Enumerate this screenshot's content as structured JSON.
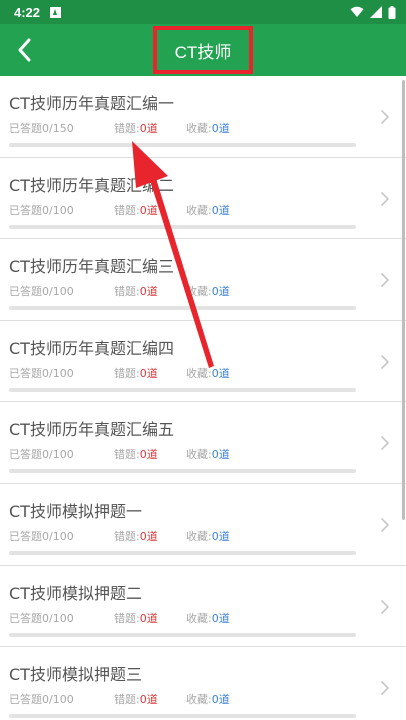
{
  "status_bar": {
    "time": "4:22",
    "icons": [
      "notification-a-icon",
      "wifi-icon",
      "signal-icon",
      "battery-icon"
    ]
  },
  "header": {
    "title": "CT技师",
    "back_icon": "back-arrow-icon"
  },
  "labels": {
    "answered": "已答题",
    "wrong": "错题:",
    "favorites": "收藏:"
  },
  "items": [
    {
      "title": "CT技师历年真题汇编一",
      "answered": "0/150",
      "wrong": "0道",
      "favorites": "0道"
    },
    {
      "title": "CT技师历年真题汇编二",
      "answered": "0/100",
      "wrong": "0道",
      "favorites": "0道"
    },
    {
      "title": "CT技师历年真题汇编三",
      "answered": "0/100",
      "wrong": "0道",
      "favorites": "0道"
    },
    {
      "title": "CT技师历年真题汇编四",
      "answered": "0/100",
      "wrong": "0道",
      "favorites": "0道"
    },
    {
      "title": "CT技师历年真题汇编五",
      "answered": "0/100",
      "wrong": "0道",
      "favorites": "0道"
    },
    {
      "title": "CT技师模拟押题一",
      "answered": "0/100",
      "wrong": "0道",
      "favorites": "0道"
    },
    {
      "title": "CT技师模拟押题二",
      "answered": "0/100",
      "wrong": "0道",
      "favorites": "0道"
    },
    {
      "title": "CT技师模拟押题三",
      "answered": "0/100",
      "wrong": "0道",
      "favorites": "0道"
    }
  ],
  "colors": {
    "header_green": "#23a352",
    "status_green": "#1e8f44",
    "highlight_red": "#e8242c",
    "wrong_red": "#d8383a",
    "favorites_blue": "#3b82d6"
  }
}
